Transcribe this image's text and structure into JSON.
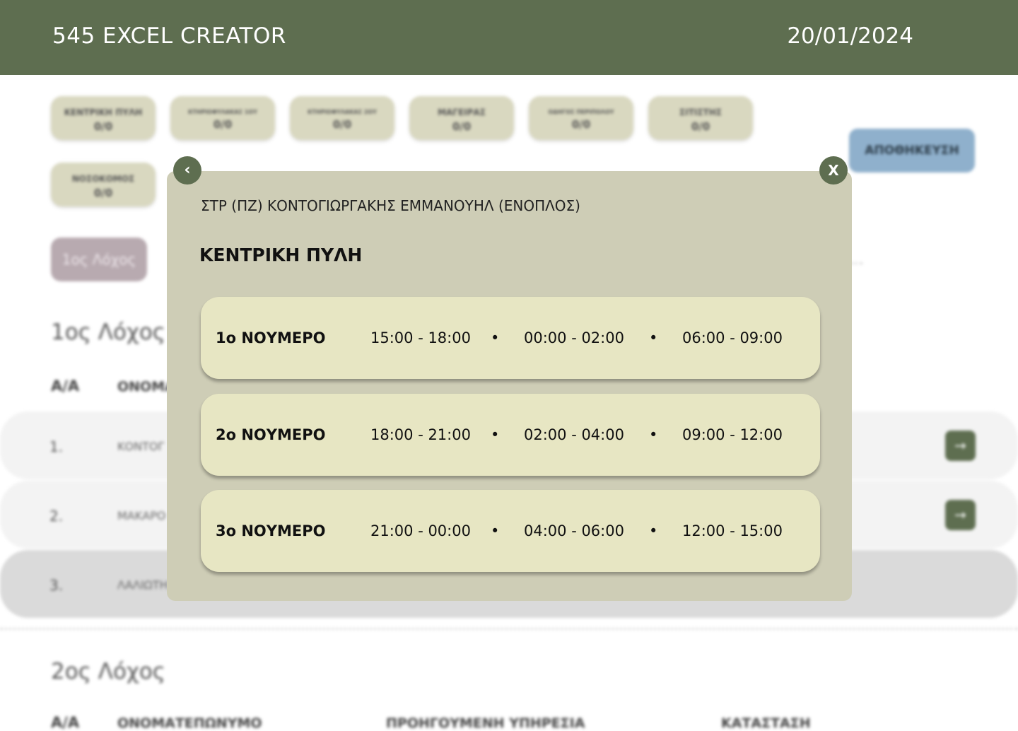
{
  "header": {
    "app_title": "545 EXCEL CREATOR",
    "date": "20/01/2024"
  },
  "posts": [
    {
      "label": "ΚΕΝΤΡΙΚΗ ΠΥΛΗ",
      "count": "0/0"
    },
    {
      "label": "ΚΤΗΡΙΟΦΥΛΑΚΑΣ 1ΟΥ",
      "count": "0/0"
    },
    {
      "label": "ΚΤΗΡΙΟΦΥΛΑΚΑΣ 2ΟΥ",
      "count": "0/0"
    },
    {
      "label": "ΜΑΓΕΙΡΑΣ",
      "count": "0/0"
    },
    {
      "label": "ΟΔΗΓΟΣ ΠΕΡΙΠΟΛΟΥ",
      "count": "0/0"
    },
    {
      "label": "ΣΙΤΙΣΤΗΣ",
      "count": "0/0"
    },
    {
      "label": "ΝΟΣΟΚΟΜΟΣ",
      "count": "0/0"
    }
  ],
  "save_label": "ΑΠΟΘΗΚΕΥΣΗ",
  "company_tab": "1ος Λόχος",
  "section1": {
    "title": "1ος Λόχος",
    "columns": {
      "aa": "A/A",
      "name": "ΟΝΟΜΑ"
    },
    "rows": [
      {
        "num": "1.",
        "name": "ΚΟΝΤΟΓ"
      },
      {
        "num": "2.",
        "name": "ΜΑΚΑΡΟ"
      },
      {
        "num": "3.",
        "name": "ΛΑΛΙΩΤΗ"
      }
    ],
    "go_icon": "→"
  },
  "section2": {
    "title": "2ος Λόχος",
    "columns": {
      "aa": "A/A",
      "name": "ΟΝΟΜΑΤΕΠΩΝΥΜΟ",
      "prev": "ΠΡΟΗΓΟΥΜΕΝΗ ΥΠΗΡΕΣΙΑ",
      "status": "ΚΑΤΑΣΤΑΣΗ"
    }
  },
  "modal": {
    "prev_icon": "‹",
    "close_icon": "X",
    "soldier": "ΣΤΡ (ΠΖ) ΚΟΝΤΟΓΙΩΡΓΑΚΗΣ ΕΜΜΑΝΟΥΗΛ (ΕΝΟΠΛΟΣ)",
    "post_title": "ΚΕΝΤΡΙΚΗ ΠΥΛΗ",
    "shifts": [
      {
        "name": "1ο ΝΟΥΜΕΡΟ",
        "times": [
          "15:00 - 18:00",
          "00:00 - 02:00",
          "06:00 - 09:00"
        ]
      },
      {
        "name": "2ο ΝΟΥΜΕΡΟ",
        "times": [
          "18:00 - 21:00",
          "02:00 - 04:00",
          "09:00 - 12:00"
        ]
      },
      {
        "name": "3ο ΝΟΥΜΕΡΟ",
        "times": [
          "21:00 - 00:00",
          "04:00 - 06:00",
          "12:00 - 15:00"
        ]
      }
    ],
    "separator": "•"
  }
}
